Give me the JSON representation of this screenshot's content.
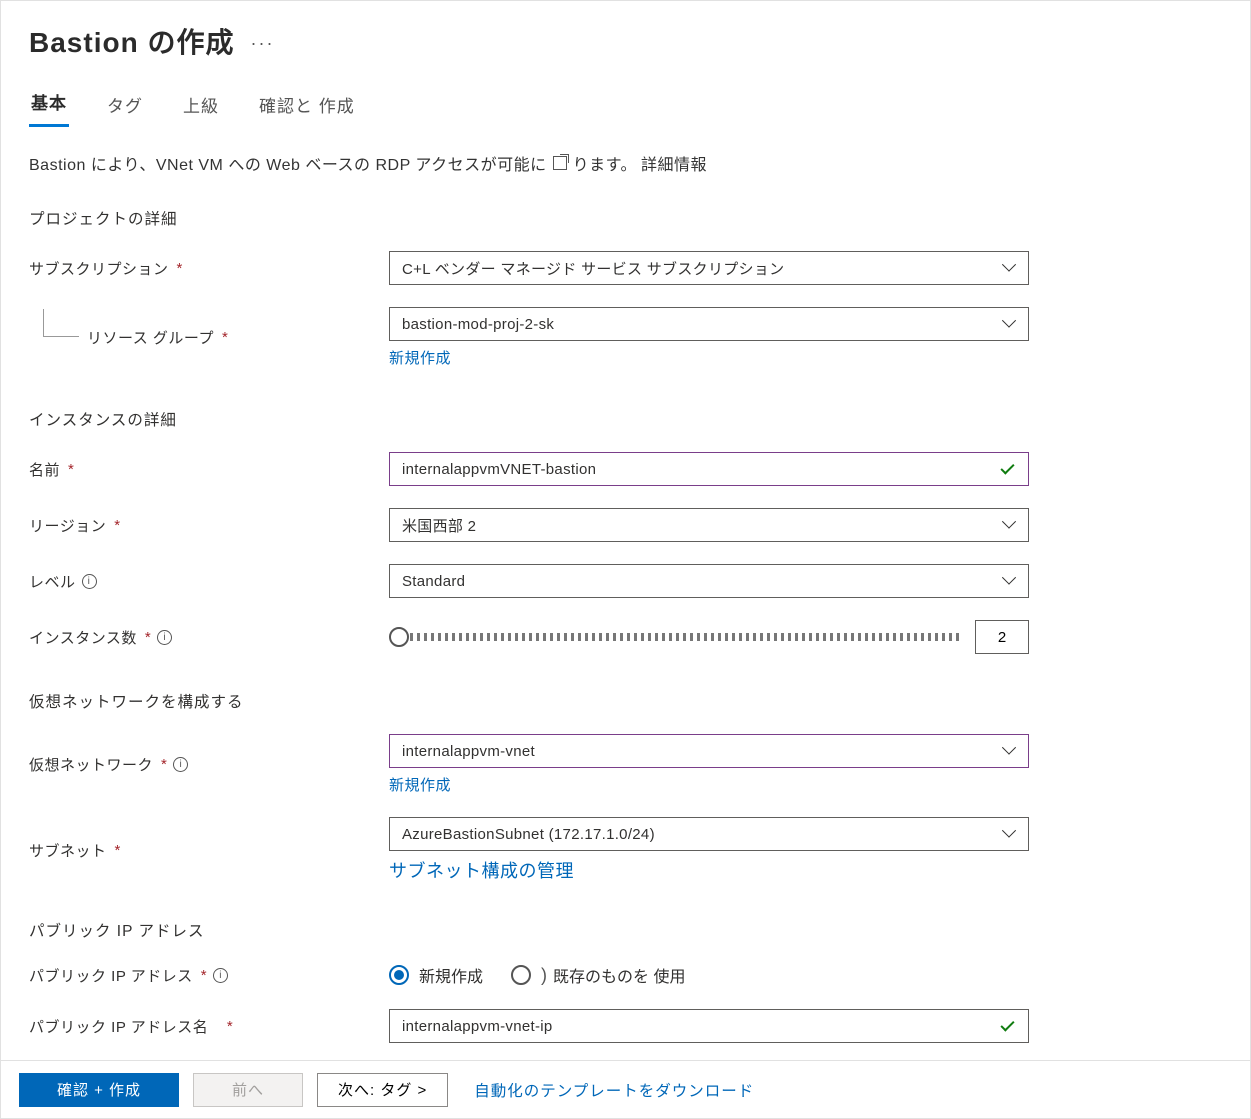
{
  "header": {
    "title": "Bastion の作成"
  },
  "tabs": {
    "basics": "基本",
    "tags": "タグ",
    "advanced": "上級",
    "review_prefix": "確認と",
    "review_suffix": "作成"
  },
  "intro": {
    "text_before": "Bastion により、VNet VM への Web ベースの RDP アクセスが可能に",
    "text_after": "ります。",
    "learn_more": "詳細情報"
  },
  "sections": {
    "project_details": "プロジェクトの詳細",
    "instance_details": "インスタンスの詳細",
    "configure_vnet": "仮想ネットワークを構成する",
    "public_ip": "パブリック IP アドレス"
  },
  "labels": {
    "subscription": "サブスクリプション",
    "resource_group": "リソース グループ",
    "create_new": "新規作成",
    "name": "名前",
    "region": "リージョン",
    "tier": "レベル",
    "instance_count": "インスタンス数",
    "virtual_network": "仮想ネットワーク",
    "subnet": "サブネット",
    "manage_subnet": "サブネット構成の管理",
    "public_ip_address": "パブリック IP アドレス",
    "public_ip_name": "パブリック IP アドレス名",
    "radio_new": "新規作成",
    "radio_existing": "既存のものを 使用"
  },
  "values": {
    "subscription": "C+L ベンダー マネージド サービス サブスクリプション",
    "resource_group": "bastion-mod-proj-2-sk",
    "name": "internalappvmVNET-bastion",
    "region": "米国西部 2",
    "tier": "Standard",
    "instance_count": "2",
    "virtual_network": "internalappvm-vnet",
    "subnet": "AzureBastionSubnet (172.17.1.0/24)",
    "public_ip_name": "internalappvm-vnet-ip"
  },
  "footer": {
    "review_create": "確認 + 作成",
    "previous": "前へ",
    "next": "次へ: タグ >",
    "download_template": "自動化のテンプレートをダウンロード"
  }
}
